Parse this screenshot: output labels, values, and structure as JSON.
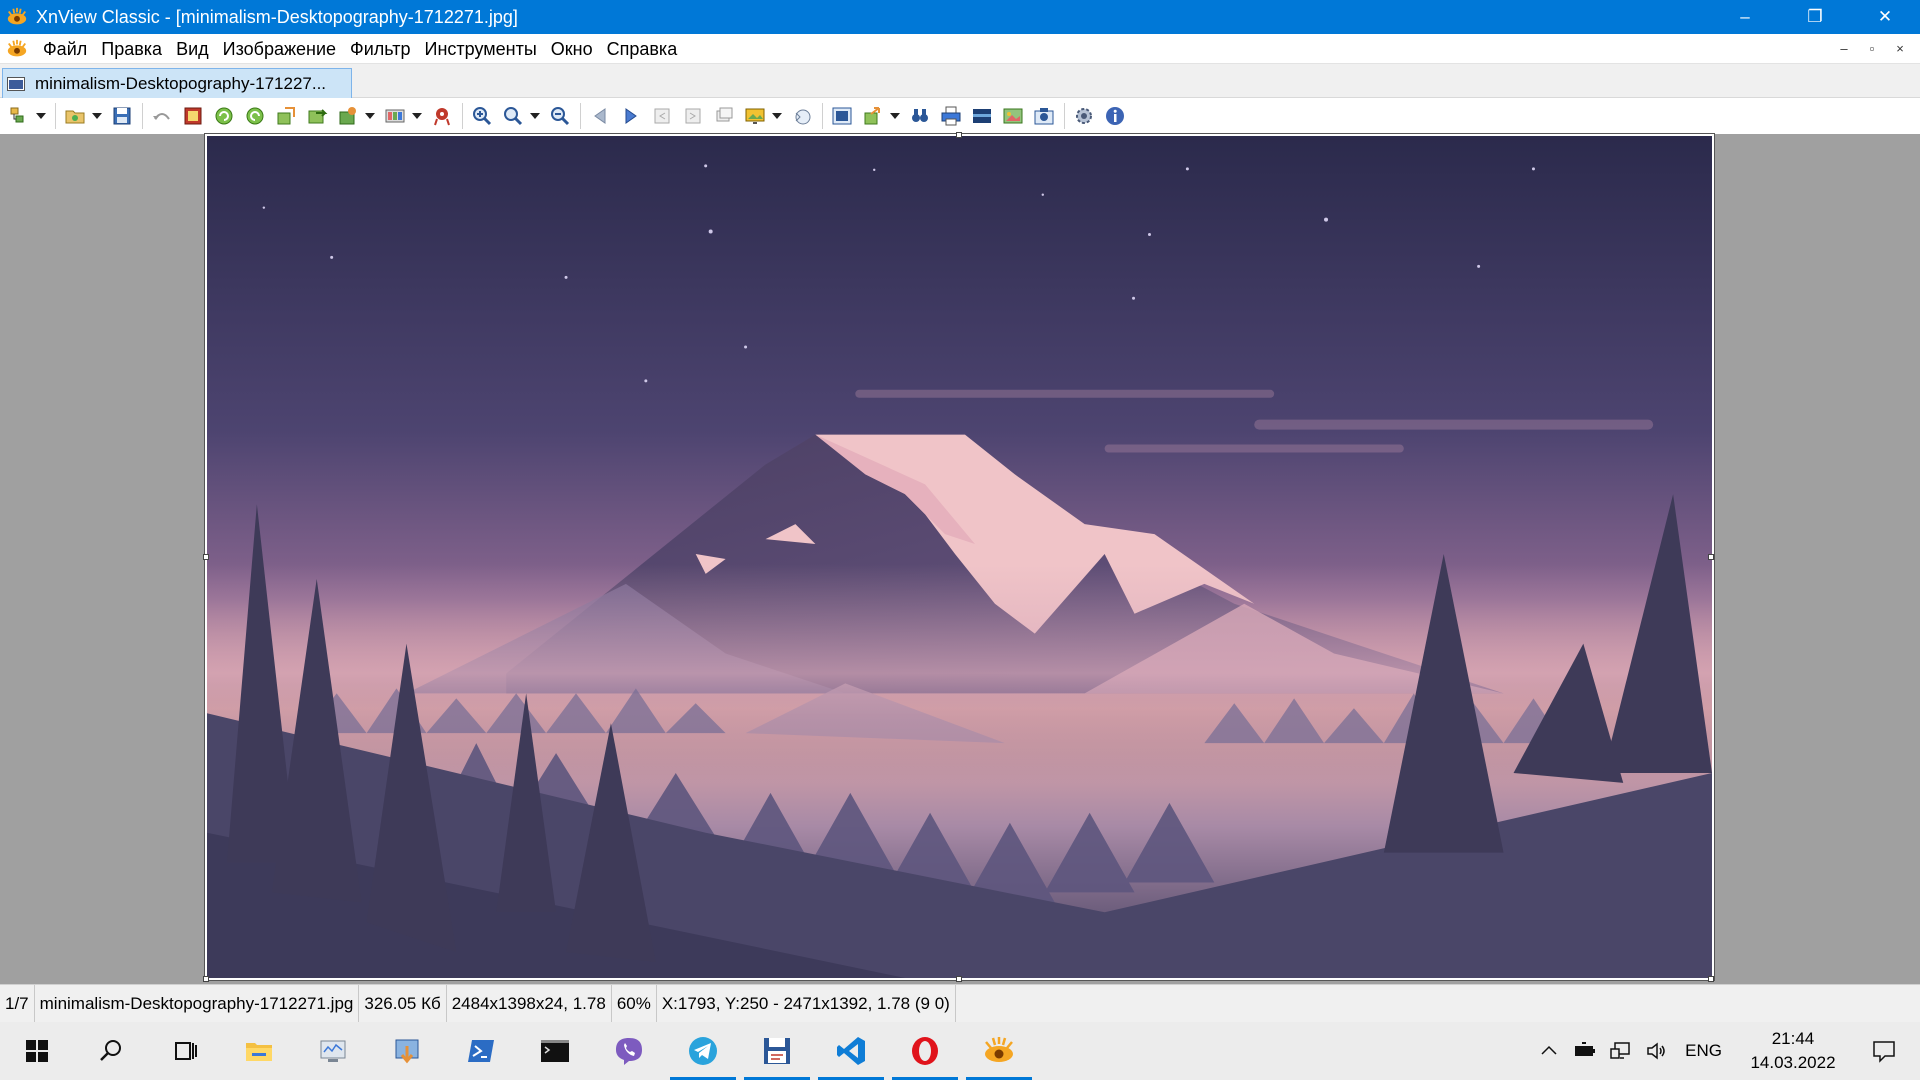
{
  "window": {
    "title": "XnView Classic - [minimalism-Desktopography-1712271.jpg]",
    "controls": {
      "minimize": "–",
      "maximize": "❐",
      "close": "✕"
    }
  },
  "menu": {
    "items": [
      "Файл",
      "Правка",
      "Вид",
      "Изображение",
      "Фильтр",
      "Инструменты",
      "Окно",
      "Справка"
    ],
    "mdi": {
      "minimize": "–",
      "restore": "▫",
      "close": "×"
    }
  },
  "tab": {
    "label": "minimalism-Desktopography-171227..."
  },
  "toolbar": {
    "icons": [
      "browser-icon",
      "open-folder-icon",
      "save-icon",
      "undo-icon",
      "fullscreen-icon",
      "rotate-left-icon",
      "rotate-right-icon",
      "export-icon",
      "forward-icon",
      "batch-icon",
      "adjust-icon",
      "red-eye-icon",
      "zoom-in-icon",
      "zoom-icon",
      "zoom-out-icon",
      "previous-icon",
      "next-icon",
      "first-icon",
      "last-icon",
      "slideshow-icon",
      "capture-icon",
      "wallpaper-icon",
      "share-icon",
      "search-icon",
      "print-icon",
      "scanner-icon",
      "photo-icon",
      "camera-icon",
      "settings-icon",
      "info-icon"
    ]
  },
  "image": {
    "palette": {
      "sky_top": "#2b2a4c",
      "sky_mid": "#5d4d7a",
      "horizon": "#e8a9a6",
      "moon": "#ffffff",
      "mountain_dark": "#4a3f63",
      "mountain_light": "#f0c4c8",
      "trees_dark": "#3e3a58",
      "ground": "#4a4668"
    }
  },
  "status": {
    "index": "1/7",
    "filename": "minimalism-Desktopography-1712271.jpg",
    "size": "326.05 Кб",
    "dimensions": "2484x1398x24, 1.78",
    "zoom": "60%",
    "selection": "X:1793, Y:250 - 2471x1392, 1.78 (9 0)"
  },
  "taskbar": {
    "apps": [
      "start-icon",
      "search-icon",
      "task-view-icon",
      "file-explorer-icon",
      "monitor-app-icon",
      "installer-icon",
      "powershell-icon",
      "terminal-icon",
      "viber-icon",
      "telegram-icon",
      "save-app-icon",
      "vscode-icon",
      "opera-icon",
      "xnview-icon"
    ],
    "active": [
      "telegram-icon",
      "save-app-icon",
      "vscode-icon",
      "opera-icon",
      "xnview-icon"
    ],
    "tray": {
      "language": "ENG",
      "time": "21:44",
      "date": "14.03.2022"
    }
  }
}
